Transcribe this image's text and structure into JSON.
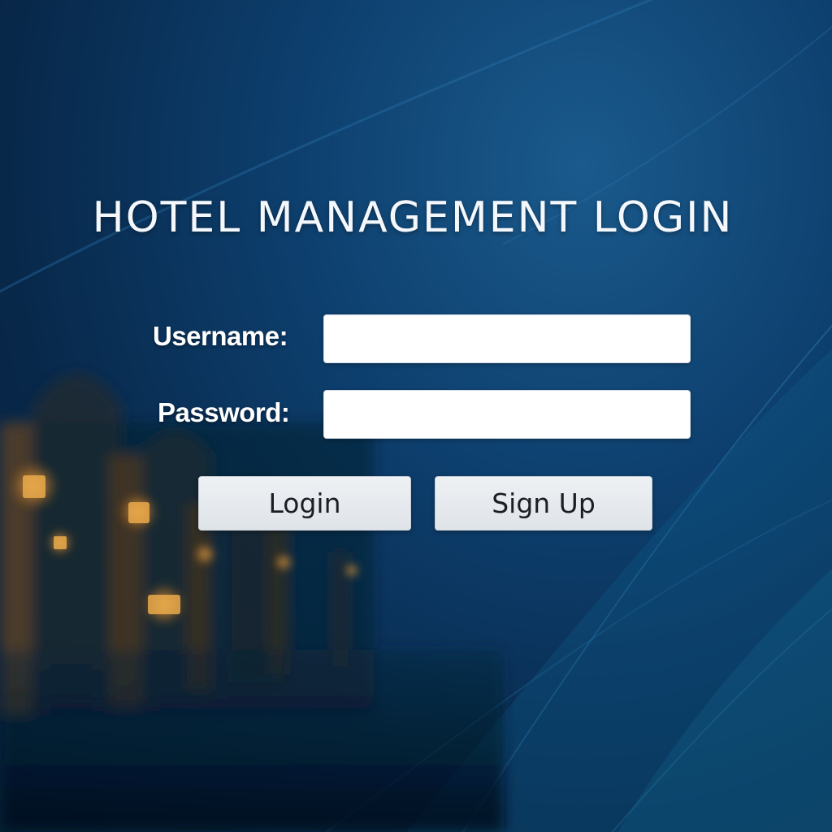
{
  "window": {
    "title": "HOTEL MANAGEMENT LOGIN"
  },
  "form": {
    "username_label": "Username:",
    "username_value": "",
    "password_label": "Password:",
    "password_value": ""
  },
  "buttons": {
    "login_label": "Login",
    "signup_label": "Sign Up"
  },
  "colors": {
    "background_dark": "#061d38",
    "background_mid": "#0d3f6e",
    "background_light": "#1a5a8c",
    "title_text": "#f4f7fb",
    "button_bg": "#e6eaee",
    "field_bg": "#ffffff",
    "lamp_glow": "#e8a040"
  }
}
